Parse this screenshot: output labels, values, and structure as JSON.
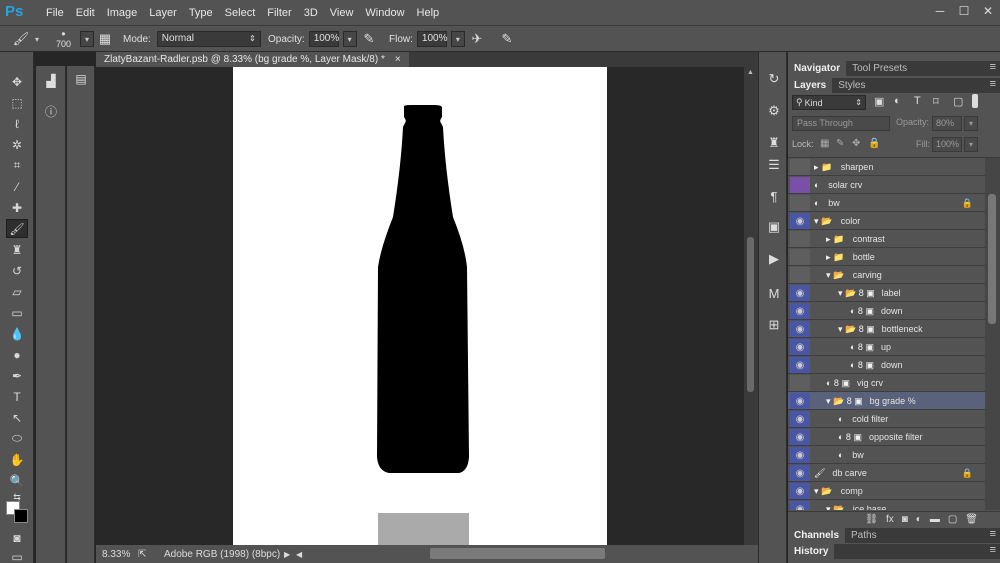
{
  "app": {
    "logo": "Ps"
  },
  "menu": [
    "File",
    "Edit",
    "Image",
    "Layer",
    "Type",
    "Select",
    "Filter",
    "3D",
    "View",
    "Window",
    "Help"
  ],
  "window_controls": [
    "─",
    "☐",
    "✕"
  ],
  "options": {
    "brush_size": "700",
    "mode_label": "Mode:",
    "mode_value": "Normal",
    "opacity_label": "Opacity:",
    "opacity_value": "100%",
    "flow_label": "Flow:",
    "flow_value": "100%"
  },
  "document": {
    "tab_title": "ZlatyBazant-Radler.psb @ 8.33% (bg grade %, Layer Mask/8) *",
    "tab_close": "×",
    "zoom": "8.33%",
    "profile": "Adobe RGB (1998) (8bpc)"
  },
  "panels": {
    "top_tabs": [
      "Navigator",
      "Tool Presets"
    ],
    "layer_tabs": [
      "Layers",
      "Styles"
    ],
    "filter_kind": "Kind",
    "blend_mode": "Pass Through",
    "opacity_label": "Opacity:",
    "opacity_value": "80%",
    "lock_label": "Lock:",
    "fill_label": "Fill:",
    "fill_value": "100%",
    "bottom_tabs": [
      "Channels",
      "Paths"
    ],
    "history_tab": "History"
  },
  "layers": [
    {
      "name": "sharpen",
      "indent": 0,
      "visible": false,
      "glyphs": "▸ 📁",
      "selected": false,
      "locked": false
    },
    {
      "name": "solar crv",
      "indent": 0,
      "visible": false,
      "glyphs": "◐",
      "selected": false,
      "locked": false,
      "purple": true
    },
    {
      "name": "bw",
      "indent": 0,
      "visible": false,
      "glyphs": "◐",
      "selected": false,
      "locked": true
    },
    {
      "name": "color",
      "indent": 0,
      "visible": true,
      "glyphs": "▾ 📂",
      "selected": false,
      "locked": false
    },
    {
      "name": "contrast",
      "indent": 1,
      "visible": false,
      "glyphs": "▸ 📁",
      "selected": false,
      "locked": false
    },
    {
      "name": "bottle",
      "indent": 1,
      "visible": false,
      "glyphs": "▸ 📁",
      "selected": false,
      "locked": false
    },
    {
      "name": "carving",
      "indent": 1,
      "visible": false,
      "glyphs": "▾ 📂",
      "selected": false,
      "locked": false
    },
    {
      "name": "label",
      "indent": 2,
      "visible": true,
      "glyphs": "▾ 📂 8 ▣",
      "selected": false,
      "locked": false
    },
    {
      "name": "down",
      "indent": 3,
      "visible": true,
      "glyphs": "◐ 8 ▣",
      "selected": false,
      "locked": false
    },
    {
      "name": "bottleneck",
      "indent": 2,
      "visible": true,
      "glyphs": "▾ 📂 8 ▣",
      "selected": false,
      "locked": false
    },
    {
      "name": "up",
      "indent": 3,
      "visible": true,
      "glyphs": "◐ 8 ▣",
      "selected": false,
      "locked": false
    },
    {
      "name": "down",
      "indent": 3,
      "visible": true,
      "glyphs": "◐ 8 ▣",
      "selected": false,
      "locked": false
    },
    {
      "name": "vig crv",
      "indent": 1,
      "visible": false,
      "glyphs": "◐ 8 ▣",
      "selected": false,
      "locked": false
    },
    {
      "name": "bg grade %",
      "indent": 1,
      "visible": true,
      "glyphs": "▾ 📂 8 ▣",
      "selected": true,
      "locked": false
    },
    {
      "name": "cold filter",
      "indent": 2,
      "visible": true,
      "glyphs": "◐",
      "selected": false,
      "locked": false
    },
    {
      "name": "opposite filter",
      "indent": 2,
      "visible": true,
      "glyphs": "◐ 8 ▣",
      "selected": false,
      "locked": false
    },
    {
      "name": "bw",
      "indent": 2,
      "visible": true,
      "glyphs": "◐",
      "selected": false,
      "locked": false
    },
    {
      "name": "db carve",
      "indent": 0,
      "visible": true,
      "glyphs": "🖌",
      "selected": false,
      "locked": true
    },
    {
      "name": "comp",
      "indent": 0,
      "visible": true,
      "glyphs": "▾ 📂",
      "selected": false,
      "locked": false
    },
    {
      "name": "ice base",
      "indent": 1,
      "visible": true,
      "glyphs": "▾ 📂",
      "selected": false,
      "locked": false
    }
  ]
}
